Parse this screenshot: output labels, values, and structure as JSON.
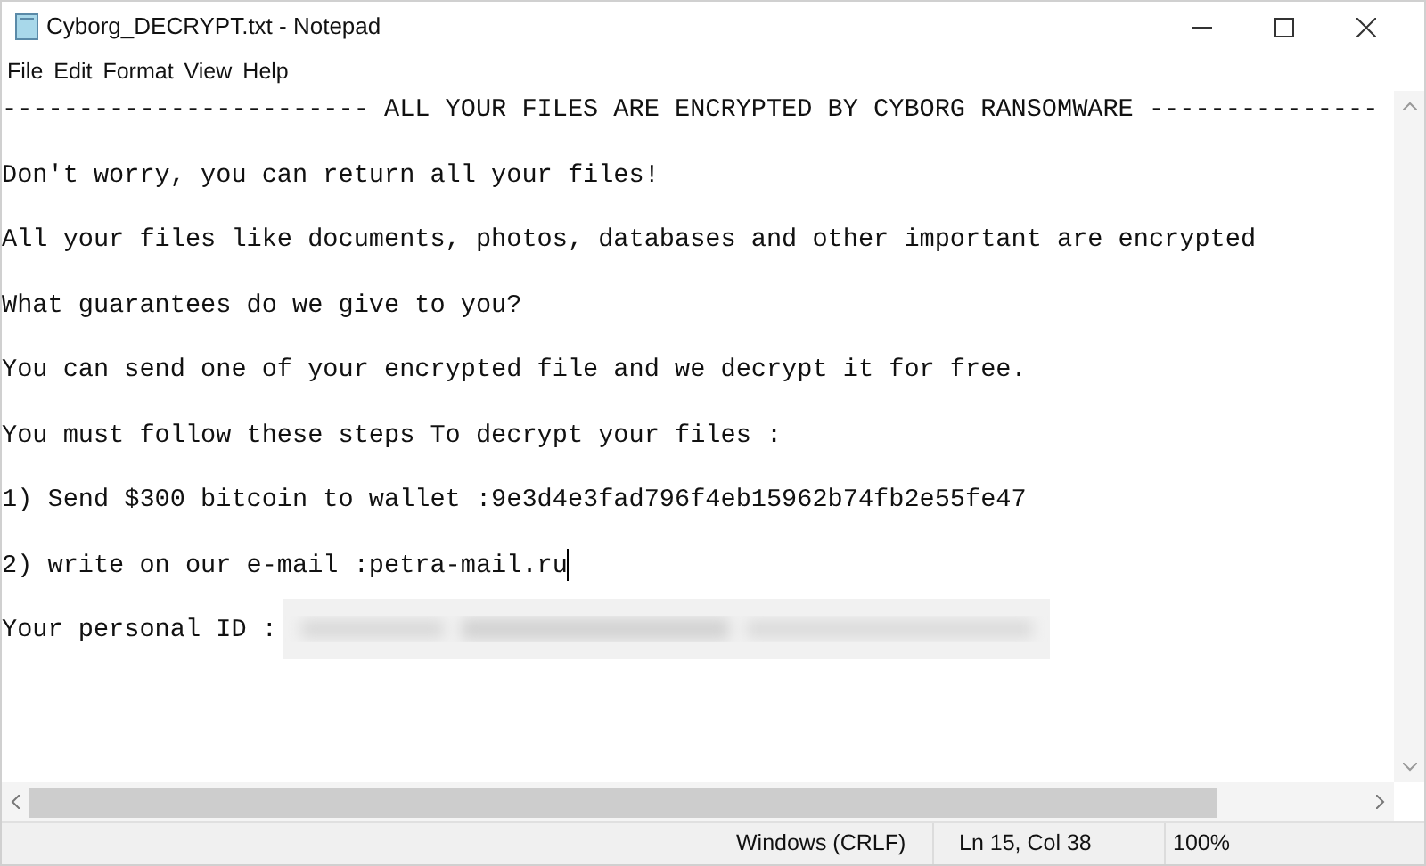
{
  "window": {
    "title": "Cyborg_DECRYPT.txt - Notepad"
  },
  "menu": [
    "File",
    "Edit",
    "Format",
    "View",
    "Help"
  ],
  "lines": [
    {
      "text": "------------------------ ALL YOUR FILES ARE ENCRYPTED BY CYBORG RANSOMWARE ---------------"
    },
    {
      "text": "Don't worry, you can return all your files!"
    },
    {
      "text": "All your files like documents, photos, databases and other important are encrypted"
    },
    {
      "text": "What guarantees do we give to you?"
    },
    {
      "text": "You can send one of your encrypted file and we decrypt it for free."
    },
    {
      "text": "You must follow these steps To decrypt your files :"
    },
    {
      "text": "1) Send $300 bitcoin to wallet :9e3d4e3fad796f4eb15962b74fb2e55fe47"
    },
    {
      "text": "2) write on our e-mail :petra-mail.ru",
      "caret": true
    },
    {
      "text": "Your personal ID :",
      "redacted": true
    }
  ],
  "status_bar": [
    "Windows (CRLF)",
    "Ln 15, Col 38",
    "100%"
  ]
}
